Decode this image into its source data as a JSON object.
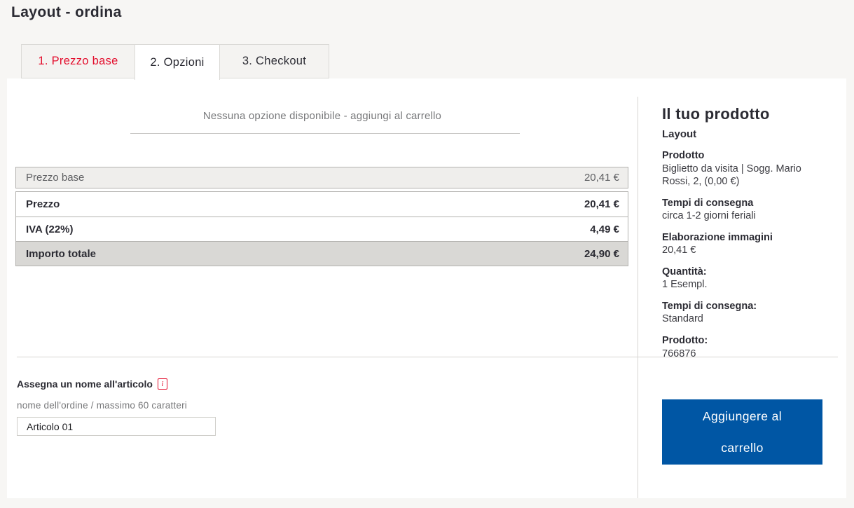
{
  "page": {
    "title": "Layout - ordina"
  },
  "tabs": [
    {
      "label": "1. Prezzo base"
    },
    {
      "label": "2. Opzioni"
    },
    {
      "label": "3. Checkout"
    }
  ],
  "options_message": "Nessuna opzione disponibile - aggiungi al carrello",
  "price_table": {
    "rows": [
      {
        "label": "Prezzo base",
        "value": "20,41 €"
      },
      {
        "label": "Prezzo",
        "value": "20,41 €"
      },
      {
        "label": "IVA (22%)",
        "value": "4,49 €"
      },
      {
        "label": "Importo totale",
        "value": "24,90 €"
      }
    ]
  },
  "product_summary": {
    "title": "Il tuo prodotto",
    "name": "Layout",
    "details": [
      {
        "label": "Prodotto",
        "value": "Biglietto da visita | Sogg. Mario Rossi, 2, (0,00 €)"
      },
      {
        "label": "Tempi di consegna",
        "value": "circa 1-2 giorni feriali"
      },
      {
        "label": "Elaborazione immagini",
        "value": "20,41 €"
      },
      {
        "label": "Quantità:",
        "value": "1 Esempl."
      },
      {
        "label": "Tempi di consegna:",
        "value": "Standard"
      },
      {
        "label": "Prodotto:",
        "value": "766876"
      }
    ]
  },
  "name_form": {
    "label": "Assegna un nome all'articolo",
    "info_icon_glyph": "i",
    "hint": "nome dell'ordine / massimo 60 caratteri",
    "input_value": "Articolo 01"
  },
  "cart_button": {
    "label": "Aggiungere al\ncarrello"
  },
  "colors": {
    "accent_blue": "#0056a4",
    "accent_red": "#e30e2d",
    "page_bg": "#f7f6f4"
  }
}
